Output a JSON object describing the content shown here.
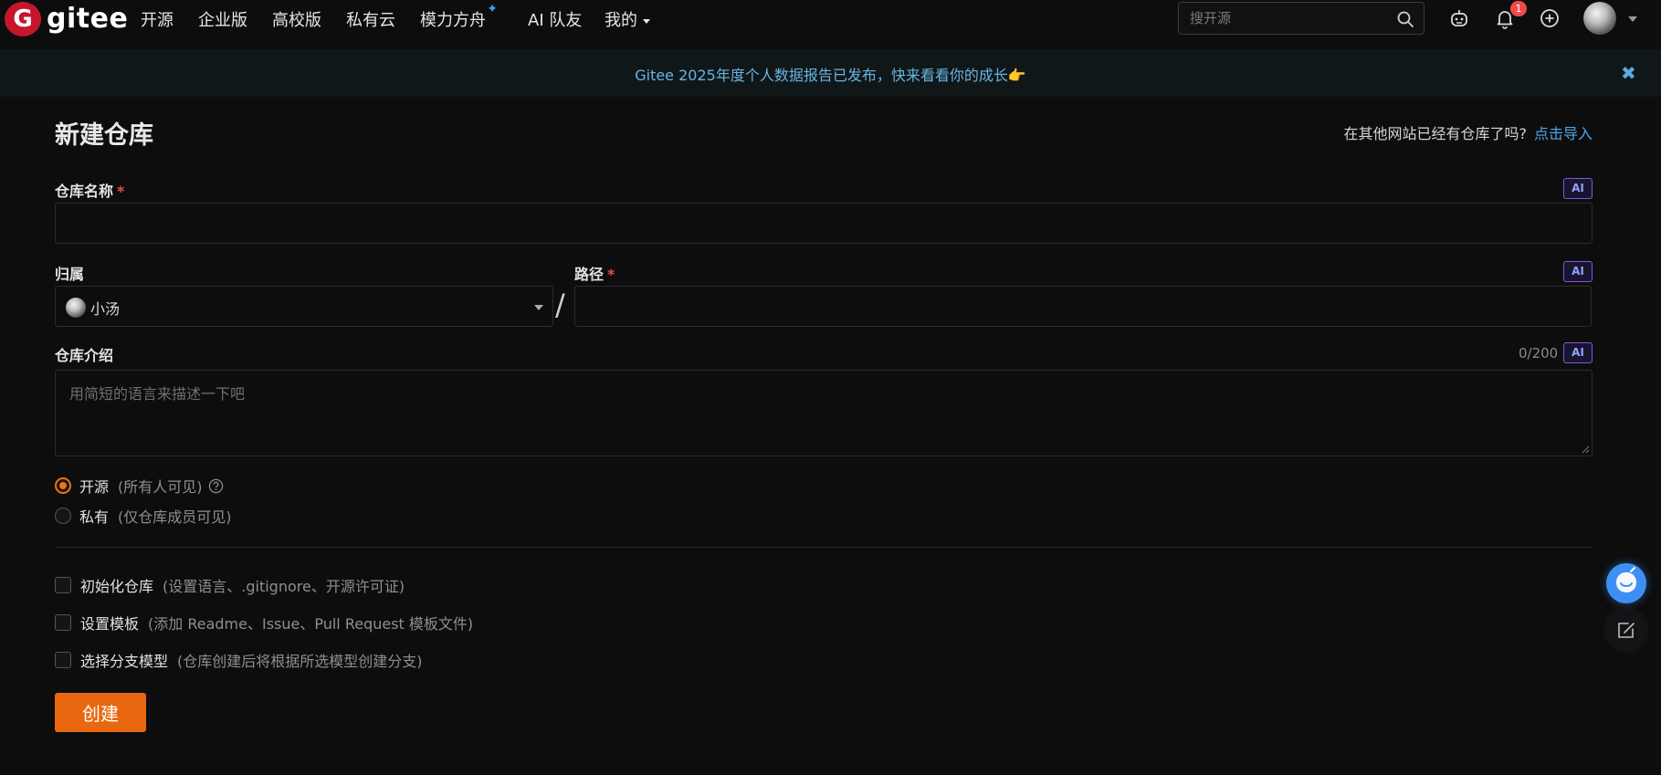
{
  "nav": {
    "logo_badge": "G",
    "logo_text": "gitee",
    "items": [
      "开源",
      "企业版",
      "高校版",
      "私有云",
      "模力方舟",
      "AI 队友",
      "我的"
    ],
    "star_glyph": "✦",
    "search_placeholder": "搜开源",
    "notification_count": "1",
    "icons": [
      "search-icon",
      "robot-icon",
      "bell-icon",
      "plus-circle-icon",
      "avatar",
      "chevron-down-icon"
    ]
  },
  "banner": {
    "text": "Gitee 2025年度个人数据报告已发布，快来看看你的成长👉",
    "close_glyph": "✖"
  },
  "form": {
    "title": "新建仓库",
    "import_hint": "在其他网站已经有仓库了吗?",
    "import_link": "点击导入",
    "repo_name_label": "仓库名称",
    "required_mark": "*",
    "ai_label": "AI",
    "repo_name_value": "",
    "owner_label": "归属",
    "owner_value": "小汤",
    "slash": "/",
    "path_label": "路径",
    "path_value": "",
    "desc_label": "仓库介绍",
    "desc_counter": "0/200",
    "desc_placeholder": "用简短的语言来描述一下吧",
    "visibility": {
      "options": [
        {
          "label": "开源",
          "note": "(所有人可见)",
          "selected": true
        },
        {
          "label": "私有",
          "note": "(仅仓库成员可见)",
          "selected": false
        }
      ]
    },
    "checks": [
      {
        "label": "初始化仓库",
        "note": "(设置语言、.gitignore、开源许可证)",
        "checked": false
      },
      {
        "label": "设置模板",
        "note": "(添加 Readme、Issue、Pull Request 模板文件)",
        "checked": false
      },
      {
        "label": "选择分支模型",
        "note": "(仓库创建后将根据所选模型创建分支)",
        "checked": false
      }
    ],
    "create_button": "创建"
  },
  "colors": {
    "accent": "#e8670f",
    "link": "#4ea6e6",
    "required": "#ef4b4b",
    "banner_text": "#69b4e0",
    "ai_border": "#7b5cd8"
  }
}
